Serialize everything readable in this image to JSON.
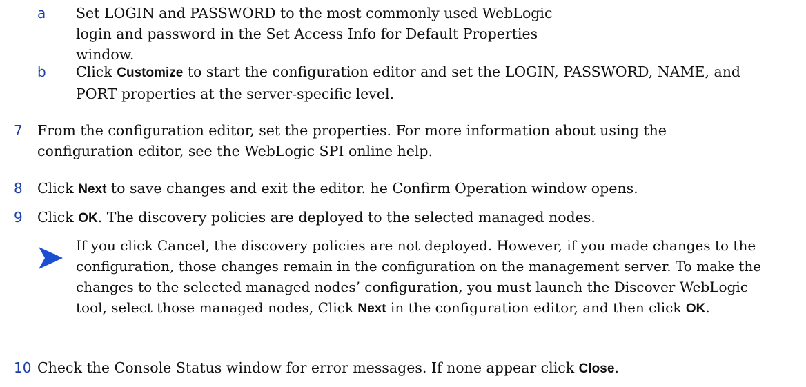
{
  "colors": {
    "marker": "#1a3fa8",
    "note_icon": "#1a4fd1",
    "text": "#111111"
  },
  "step_6a": {
    "marker": "a",
    "text": "Set LOGIN and PASSWORD to the most commonly used WebLogic login and password in the Set Access Info for Default Properties window."
  },
  "step_6b": {
    "marker": "b",
    "pre": "Click ",
    "kw": "Customize",
    "post": " to start the configuration editor and set the LOGIN, PASSWORD, NAME, and PORT properties at the server-specific level."
  },
  "step_7": {
    "marker": "7",
    "text": "From the configuration editor, set the properties. For more information about using the configuration editor, see the WebLogic SPI online help."
  },
  "step_8": {
    "marker": "8",
    "pre": "Click ",
    "kw": "Next",
    "post": " to save changes and exit the editor. he Confirm Operation window opens."
  },
  "step_9": {
    "marker": "9",
    "pre": "Click ",
    "kw": "OK",
    "post": ". The discovery policies are deployed to the selected managed nodes."
  },
  "note": {
    "icon": "arrow-right-icon",
    "pre": "If you click Cancel, the discovery policies are not deployed. However, if you made changes to the configuration, those changes remain in the configuration on the management server. To make the changes to the selected managed nodes’ configuration, you must launch the Discover WebLogic tool, select those managed nodes, Click ",
    "kw1": "Next",
    "mid": " in the configuration editor, and then click ",
    "kw2": "OK",
    "post": "."
  },
  "step_10": {
    "marker": "10",
    "pre": "Check the Console Status window for error messages. If none appear click ",
    "kw": "Close",
    "post": "."
  }
}
